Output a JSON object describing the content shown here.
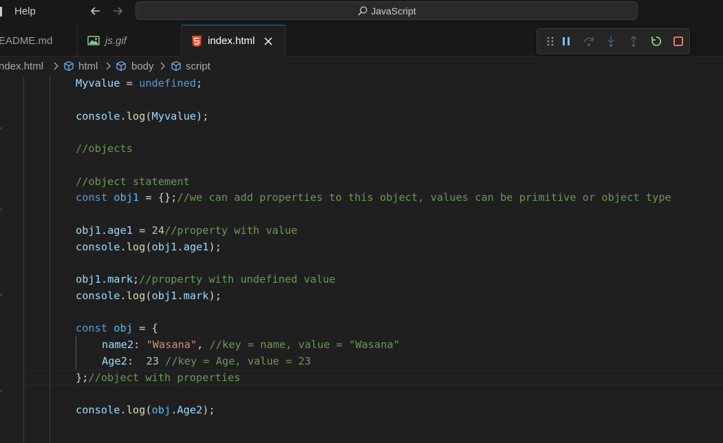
{
  "titlebar": {
    "menu_help": "Help",
    "search_text": "JavaScript"
  },
  "tabs": [
    {
      "label": "EADME.md",
      "active": false
    },
    {
      "label": "js.gif",
      "active": false
    },
    {
      "label": "index.html",
      "active": true
    }
  ],
  "breadcrumb": [
    "ndex.html",
    "html",
    "body",
    "script"
  ],
  "code": {
    "l1": {
      "a": "Myvalue",
      "b": " = ",
      "c": "undefined",
      "d": ";"
    },
    "l2": {
      "a": "console",
      "b": ".",
      "c": "log",
      "d": "(",
      "e": "Myvalue",
      "f": ");"
    },
    "l3": {
      "a": "//objects"
    },
    "l4": {
      "a": "//object statement"
    },
    "l5": {
      "a": "const",
      "b": " ",
      "c": "obj1",
      "d": " = {};",
      "e": "//we can add properties to this object, values can be primitive or object type"
    },
    "l6": {
      "a": "obj1",
      "b": ".",
      "c": "age1",
      "d": " = ",
      "e": "24",
      "f": "//property with value"
    },
    "l7": {
      "a": "console",
      "b": ".",
      "c": "log",
      "d": "(",
      "e": "obj1",
      "f": ".",
      "g": "age1",
      "h": ");"
    },
    "l8": {
      "a": "obj1",
      "b": ".",
      "c": "mark",
      "d": ";",
      "e": "//property with undefined value"
    },
    "l9": {
      "a": "console",
      "b": ".",
      "c": "log",
      "d": "(",
      "e": "obj1",
      "f": ".",
      "g": "mark",
      "h": ");"
    },
    "l10": {
      "a": "const",
      "b": " ",
      "c": "obj",
      "d": " = {"
    },
    "l11": {
      "a": "name2",
      "b": ": ",
      "c": "\"Wasana\"",
      "d": ", ",
      "e": "//key = name, value = \"Wasana\""
    },
    "l12": {
      "a": "Age2",
      "b": ":  ",
      "c": "23",
      "d": " ",
      "e": "//key = Age, value = 23"
    },
    "l13": {
      "a": "};",
      "b": "//object with properties"
    },
    "l14": {
      "a": "console",
      "b": ".",
      "c": "log",
      "d": "(",
      "e": "obj",
      "f": ".",
      "g": "Age2",
      "h": ");"
    }
  },
  "colors": {
    "accent": "#0078d4",
    "debug_action": "#75beff",
    "restart": "#89d185",
    "stop": "#f48771",
    "html_icon": "#e44d26",
    "image_icon": "#8dc891"
  },
  "icons": [
    "back-arrow-icon",
    "forward-arrow-icon",
    "search-icon",
    "image-file-icon",
    "html5-file-icon",
    "close-icon",
    "symbol-class-icon",
    "chevron-right-icon",
    "drag-gripper-icon",
    "pause-icon",
    "step-over-icon",
    "step-into-icon",
    "step-out-icon",
    "restart-icon",
    "stop-icon"
  ]
}
